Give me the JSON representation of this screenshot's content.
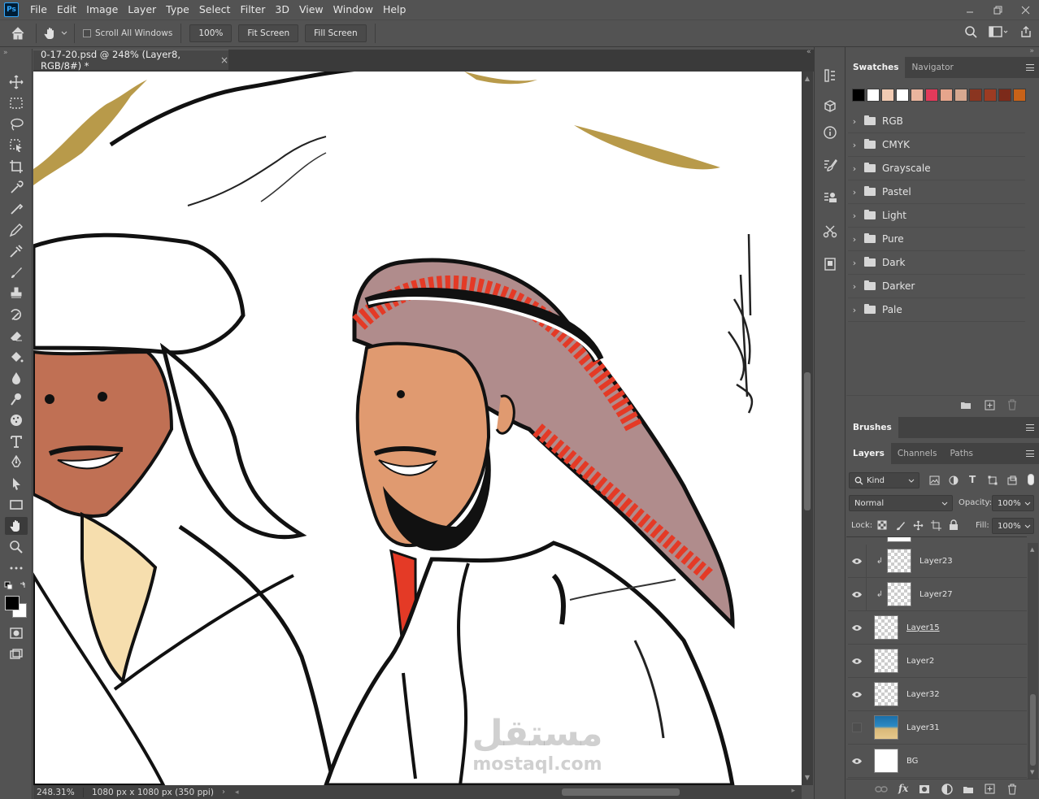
{
  "app": {
    "logo": "Ps"
  },
  "menu": [
    "File",
    "Edit",
    "Image",
    "Layer",
    "Type",
    "Select",
    "Filter",
    "3D",
    "View",
    "Window",
    "Help"
  ],
  "options": {
    "scroll_all_windows": "Scroll All Windows",
    "zoom_value": "100%",
    "fit_screen": "Fit Screen",
    "fill_screen": "Fill Screen"
  },
  "document": {
    "tab_title": "0-17-20.psd @ 248% (Layer8, RGB/8#) *",
    "close_glyph": "×"
  },
  "status": {
    "zoom": "248.31%",
    "doc_info": "1080 px x 1080 px (350 ppi)"
  },
  "swatches_panel": {
    "tabs": [
      "Swatches",
      "Navigator"
    ],
    "colors": [
      "#000000",
      "#ffffff",
      "#f2cbb3",
      "#ffffff",
      "#eab59e",
      "#e23a5a",
      "#e6a58c",
      "#d6a890",
      "#8a3520",
      "#9c3b22",
      "#7c2a1a",
      "#c86218"
    ],
    "groups": [
      "RGB",
      "CMYK",
      "Grayscale",
      "Pastel",
      "Light",
      "Pure",
      "Dark",
      "Darker",
      "Pale"
    ]
  },
  "brushes_panel": {
    "title": "Brushes"
  },
  "layers_panel": {
    "tabs": [
      "Layers",
      "Channels",
      "Paths"
    ],
    "filter_kind": "Kind",
    "blend_mode": "Normal",
    "opacity_label": "Opacity:",
    "opacity_value": "100%",
    "lock_label": "Lock:",
    "fill_label": "Fill:",
    "fill_value": "100%",
    "layers": [
      {
        "name": "Layer23",
        "visible": true,
        "clipped": true
      },
      {
        "name": "Layer27",
        "visible": true,
        "clipped": true
      },
      {
        "name": "Layer15",
        "visible": true,
        "clipped": false
      },
      {
        "name": "Layer2",
        "visible": true,
        "clipped": false
      },
      {
        "name": "Layer32",
        "visible": true,
        "clipped": false
      },
      {
        "name": "Layer31",
        "visible": false,
        "clipped": false
      },
      {
        "name": "BG",
        "visible": true,
        "clipped": false
      }
    ]
  },
  "watermark": {
    "arabic": "مستقل",
    "latin": "mostaql.com"
  }
}
